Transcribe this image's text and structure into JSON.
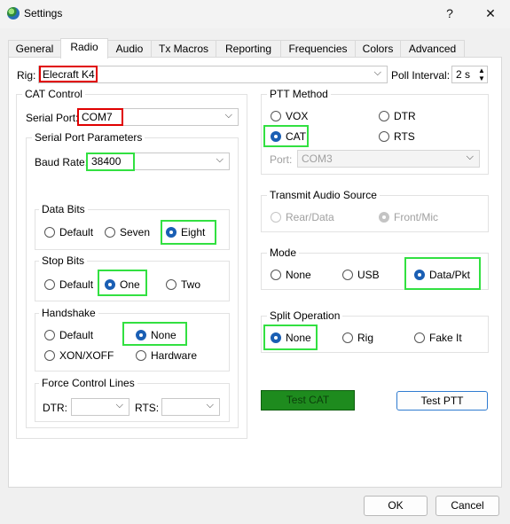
{
  "window": {
    "title": "Settings",
    "help_label": "?",
    "close_label": "✕"
  },
  "tabs": [
    "General",
    "Radio",
    "Audio",
    "Tx Macros",
    "Reporting",
    "Frequencies",
    "Colors",
    "Advanced"
  ],
  "rig": {
    "label": "Rig:",
    "value": "Elecraft K4",
    "poll_label": "Poll Interval:",
    "poll_value": "2 s"
  },
  "cat": {
    "title": "CAT Control",
    "serial_port_label": "Serial Port:",
    "serial_port_value": "COM7",
    "params_title": "Serial Port Parameters",
    "baud_label": "Baud Rate:",
    "baud_value": "38400",
    "data_bits": {
      "title": "Data Bits",
      "options": [
        "Default",
        "Seven",
        "Eight"
      ],
      "selected": "Eight"
    },
    "stop_bits": {
      "title": "Stop Bits",
      "options": [
        "Default",
        "One",
        "Two"
      ],
      "selected": "One"
    },
    "handshake": {
      "title": "Handshake",
      "options": [
        "Default",
        "None",
        "XON/XOFF",
        "Hardware"
      ],
      "selected": "None"
    },
    "force": {
      "title": "Force Control Lines",
      "dtr_label": "DTR:",
      "rts_label": "RTS:",
      "dtr_value": "",
      "rts_value": ""
    }
  },
  "ptt": {
    "title": "PTT Method",
    "options": [
      "VOX",
      "DTR",
      "CAT",
      "RTS"
    ],
    "selected": "CAT",
    "port_label": "Port:",
    "port_value": "COM3"
  },
  "audio_source": {
    "title": "Transmit Audio Source",
    "options": [
      "Rear/Data",
      "Front/Mic"
    ],
    "selected": "Front/Mic"
  },
  "mode": {
    "title": "Mode",
    "options": [
      "None",
      "USB",
      "Data/Pkt"
    ],
    "selected": "Data/Pkt"
  },
  "split": {
    "title": "Split Operation",
    "options": [
      "None",
      "Rig",
      "Fake It"
    ],
    "selected": "None"
  },
  "buttons": {
    "test_cat": "Test CAT",
    "test_ptt": "Test PTT",
    "ok": "OK",
    "cancel": "Cancel"
  },
  "colors": {
    "test_cat_bg": "#1e8b1e",
    "highlight_red": "#e00000",
    "highlight_green": "#32e041",
    "radio_on": "#1a5fb4"
  }
}
